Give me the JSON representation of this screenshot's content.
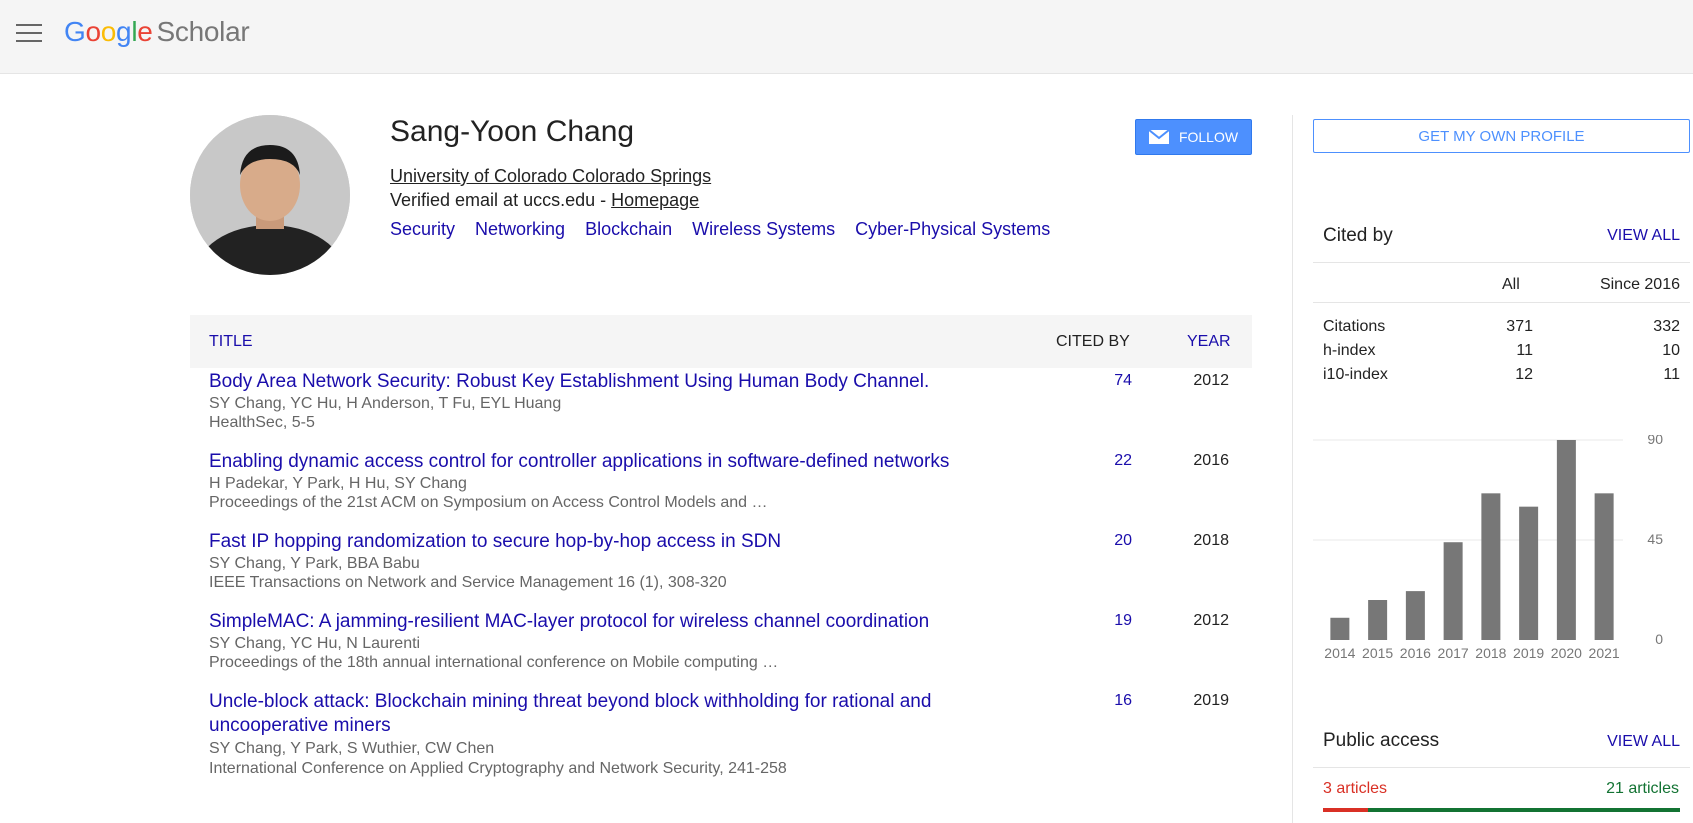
{
  "header": {
    "logo_letters": [
      "G",
      "o",
      "o",
      "g",
      "l",
      "e"
    ],
    "logo_product": "Scholar"
  },
  "profile": {
    "name": "Sang-Yoon Chang",
    "affiliation": "University of Colorado Colorado Springs",
    "email_text": "Verified email at uccs.edu - ",
    "homepage_label": "Homepage",
    "interests": [
      "Security",
      "Networking",
      "Blockchain",
      "Wireless Systems",
      "Cyber-Physical Systems"
    ],
    "follow_label": "FOLLOW"
  },
  "table": {
    "col_title": "TITLE",
    "col_cited_by": "CITED BY",
    "col_year": "YEAR",
    "rows": [
      {
        "title": "Body Area Network Security: Robust Key Establishment Using Human Body Channel.",
        "authors": "SY Chang, YC Hu, H Anderson, T Fu, EYL Huang",
        "venue": "HealthSec, 5-5",
        "cited_by": "74",
        "year": "2012"
      },
      {
        "title": "Enabling dynamic access control for controller applications in software-defined networks",
        "authors": "H Padekar, Y Park, H Hu, SY Chang",
        "venue": "Proceedings of the 21st ACM on Symposium on Access Control Models and …",
        "cited_by": "22",
        "year": "2016"
      },
      {
        "title": "Fast IP hopping randomization to secure hop-by-hop access in SDN",
        "authors": "SY Chang, Y Park, BBA Babu",
        "venue": "IEEE Transactions on Network and Service Management 16 (1), 308-320",
        "cited_by": "20",
        "year": "2018"
      },
      {
        "title": "SimpleMAC: A jamming-resilient MAC-layer protocol for wireless channel coordination",
        "authors": "SY Chang, YC Hu, N Laurenti",
        "venue": "Proceedings of the 18th annual international conference on Mobile computing …",
        "cited_by": "19",
        "year": "2012"
      },
      {
        "title": "Uncle-block attack: Blockchain mining threat beyond block withholding for rational and uncooperative miners",
        "authors": "SY Chang, Y Park, S Wuthier, CW Chen",
        "venue": "International Conference on Applied Cryptography and Network Security, 241-258",
        "cited_by": "16",
        "year": "2019"
      }
    ]
  },
  "sidebar": {
    "get_profile_label": "GET MY OWN PROFILE",
    "cited_by_title": "Cited by",
    "view_all_label": "VIEW ALL",
    "col_all": "All",
    "col_since": "Since 2016",
    "stats": [
      {
        "label": "Citations",
        "all": "371",
        "since": "332"
      },
      {
        "label": "h-index",
        "all": "11",
        "since": "10"
      },
      {
        "label": "i10-index",
        "all": "12",
        "since": "11"
      }
    ],
    "public_access_title": "Public access",
    "pa_view_all_label": "VIEW ALL",
    "pa_unavailable": "3 articles",
    "pa_available": "21 articles",
    "pa_fraction": 0.125
  },
  "chart_data": {
    "type": "bar",
    "categories": [
      "2014",
      "2015",
      "2016",
      "2017",
      "2018",
      "2019",
      "2020",
      "2021"
    ],
    "values": [
      10,
      18,
      22,
      44,
      66,
      60,
      90,
      66
    ],
    "ylim": [
      0,
      90
    ],
    "yticks": [
      "90",
      "45",
      "0"
    ],
    "bar_color": "#777777"
  }
}
